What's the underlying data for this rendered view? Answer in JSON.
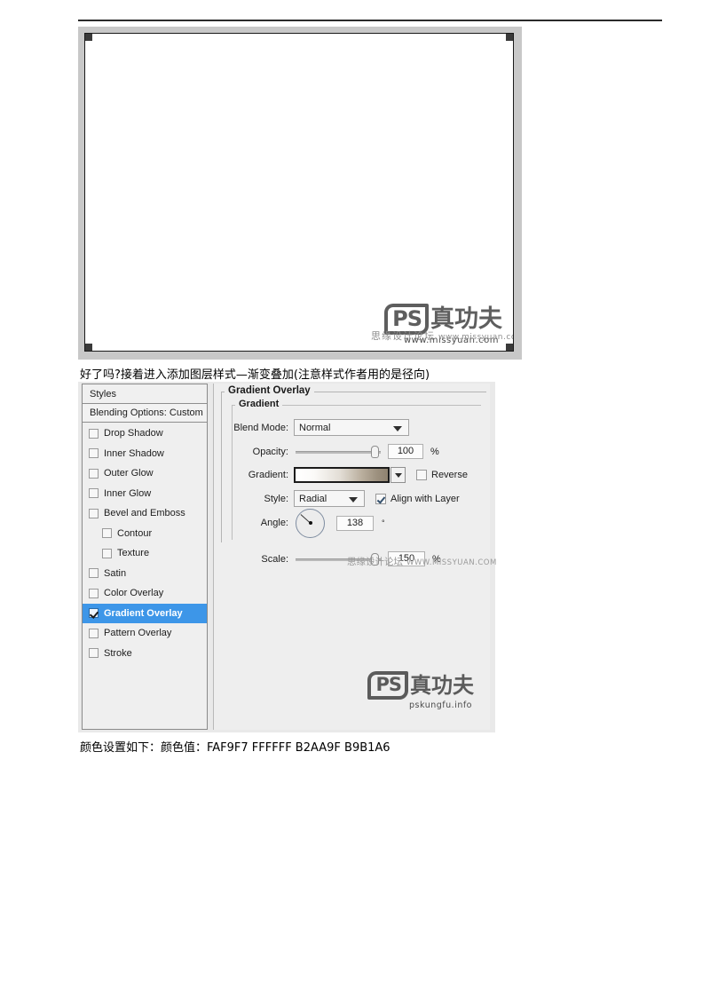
{
  "page": {
    "caption_top": "好了吗?接着进入添加图层样式—渐变叠加(注意样式作者用的是径向)",
    "caption_bottom": "颜色设置如下：颜色值：FAF9F7  FFFFFF  B2AA9F  B9B1A6"
  },
  "watermarks": {
    "ps_badge": "PS",
    "brand_cn": "真功夫",
    "site_info": "pskungfu.info",
    "forum_cn": "思缘设计论坛",
    "forum_url_caps": "WWW.MISSYUAN.COM",
    "forum_url_lower": "www.missyuan.com"
  },
  "dialog": {
    "styles_panel": {
      "header": "Styles",
      "blending_options": "Blending Options: Custom",
      "items": [
        {
          "label": "Drop Shadow",
          "checked": false,
          "indent": false,
          "selected": false
        },
        {
          "label": "Inner Shadow",
          "checked": false,
          "indent": false,
          "selected": false
        },
        {
          "label": "Outer Glow",
          "checked": false,
          "indent": false,
          "selected": false
        },
        {
          "label": "Inner Glow",
          "checked": false,
          "indent": false,
          "selected": false
        },
        {
          "label": "Bevel and Emboss",
          "checked": false,
          "indent": false,
          "selected": false
        },
        {
          "label": "Contour",
          "checked": false,
          "indent": true,
          "selected": false
        },
        {
          "label": "Texture",
          "checked": false,
          "indent": true,
          "selected": false
        },
        {
          "label": "Satin",
          "checked": false,
          "indent": false,
          "selected": false
        },
        {
          "label": "Color Overlay",
          "checked": false,
          "indent": false,
          "selected": false
        },
        {
          "label": "Gradient Overlay",
          "checked": true,
          "indent": false,
          "selected": true
        },
        {
          "label": "Pattern Overlay",
          "checked": false,
          "indent": false,
          "selected": false
        },
        {
          "label": "Stroke",
          "checked": false,
          "indent": false,
          "selected": false
        }
      ]
    },
    "settings": {
      "section_title": "Gradient Overlay",
      "group_title": "Gradient",
      "blend_mode_label": "Blend Mode:",
      "blend_mode_value": "Normal",
      "opacity_label": "Opacity:",
      "opacity_value": "100",
      "opacity_unit": "%",
      "gradient_label": "Gradient:",
      "reverse_label": "Reverse",
      "reverse_checked": false,
      "style_label": "Style:",
      "style_value": "Radial",
      "align_with_layer_label": "Align with Layer",
      "align_with_layer_checked": true,
      "angle_label": "Angle:",
      "angle_value": "138",
      "angle_unit": "°",
      "scale_label": "Scale:",
      "scale_value": "150",
      "scale_unit": "%"
    }
  },
  "colors": {
    "selection_blue": "#3d96e8",
    "dialog_bg": "#e9e9e9",
    "panel_bg": "#eeeeee",
    "gradient_stops": [
      "#FAF9F7",
      "#FFFFFF",
      "#B2AA9F",
      "#B9B1A6"
    ]
  }
}
